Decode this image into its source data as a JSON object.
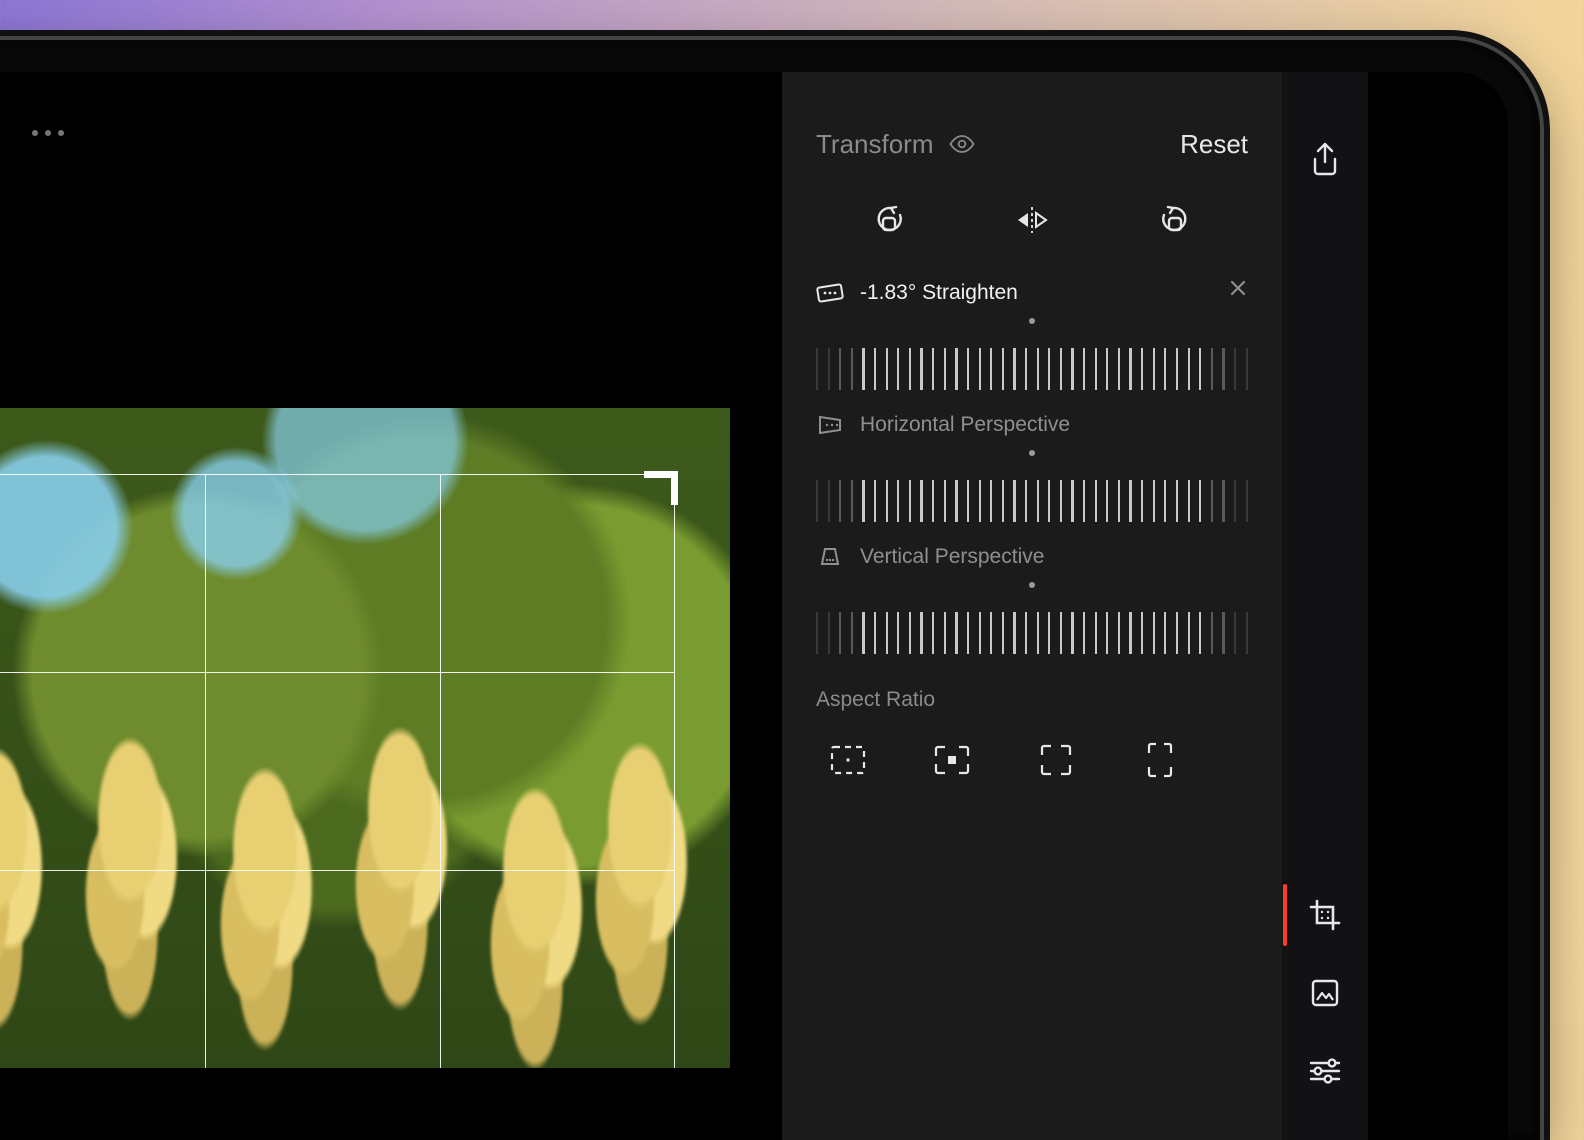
{
  "panel": {
    "title": "Transform",
    "reset": "Reset"
  },
  "controls": {
    "straighten": {
      "value": "-1.83°",
      "label": "Straighten"
    },
    "horizontalPerspective": {
      "label": "Horizontal Perspective"
    },
    "verticalPerspective": {
      "label": "Vertical Perspective"
    }
  },
  "aspect": {
    "title": "Aspect Ratio"
  },
  "icons": {
    "rotateLeft": "rotate-left",
    "flipH": "flip-horizontal",
    "rotateRight": "rotate-right",
    "freeform": "freeform",
    "original": "original",
    "square": "square",
    "portrait": "portrait"
  },
  "toolstrip": {
    "share": "share-icon",
    "crop": "crop-icon",
    "filters": "filters-icon",
    "adjust": "adjust-icon"
  }
}
